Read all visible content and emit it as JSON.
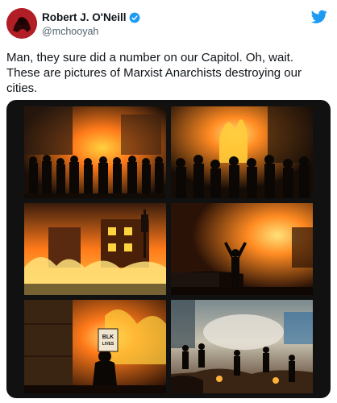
{
  "author": {
    "display_name": "Robert J. O'Neill",
    "handle": "@mchooyah",
    "verified": true,
    "avatar_icon": "avatar-icon"
  },
  "brand": {
    "icon": "twitter-bird-icon",
    "color": "#1d9bf0"
  },
  "tweet": {
    "text": "Man, they sure did a number on our Capitol. Oh, wait.\nThese are pictures of Marxist Anarchists destroying our\ncities."
  },
  "media": {
    "photos": [
      {
        "name": "photo-riot-police-line"
      },
      {
        "name": "photo-crowd-before-fire"
      },
      {
        "name": "photo-burning-building"
      },
      {
        "name": "photo-silhouette-raised-arms"
      },
      {
        "name": "photo-protester-sign",
        "sign_text": "BLK LIVES MATTER"
      },
      {
        "name": "photo-street-smoke-crowd"
      }
    ]
  },
  "colors": {
    "fire_orange": "#ff7a1a",
    "fire_yellow": "#ffd23f",
    "night": "#1a0f08",
    "verified_blue": "#1d9bf0"
  }
}
